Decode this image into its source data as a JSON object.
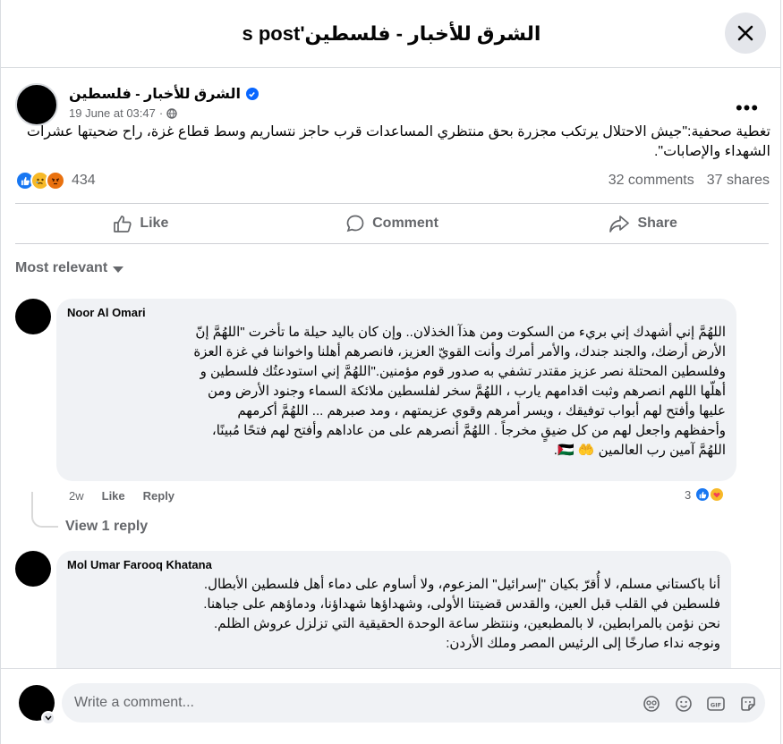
{
  "header": {
    "title": "الشرق للأخبار - فلسطين's post"
  },
  "post": {
    "author": "الشرق للأخبار - فلسطين",
    "time": "19 June at 03:47",
    "text": "تغطية صحفية:\"جيش الاحتلال يرتكب مجزرة بحق منتظري المساعدات قرب حاجز نتساريم وسط قطاع غزة، راح ضحيتها عشرات الشهداء والإصابات\".",
    "reaction_count": "434",
    "comments": "32 comments",
    "shares": "37 shares"
  },
  "actions": {
    "like": "Like",
    "comment": "Comment",
    "share": "Share"
  },
  "sort": {
    "label": "Most relevant"
  },
  "comments": [
    {
      "name": "Noor Al Omari",
      "lines": [
        "اللهُمَّ إني أشهدك إني بريء من السكوت ومن هذآ الخذلان.. وإن كان باليد حيلة ما تأخرت \"اللهُمَّ إنّ",
        "الأرض أرضك، والجند جندك، والأمر أمرك وأنت القويّ العزيز، فانصرهم أهلنا واخواننا في غزة العزة",
        "وفلسطين المحتلة نصر عزيز مقتدر تشفي به صدور قوم مؤمنين.\"اللهُمَّ إني استودعتُك فلسطين و",
        "أهلّها اللهم انصرهم وثبت اقدامهم يارب ، اللهُمَّ سخر لفلسطين ملائكة السماء وجنود الأرض ومن",
        "عليها وأفتح لهم أبواب توفيقك ، ويسر أمرهم وقوي عزيمتهم ، ومد صبرهم ... اللهُمَّ أكرمهم",
        "وأحفظهم واجعل لهم من كل ضيقٍ مخرجاً . اللهُمَّ أنصرهم على من عاداهم وأفتح لهم فتحًا مُبينًا،",
        "اللهُمَّ آمين رب العالمين 🤲 🇵🇸."
      ],
      "time": "2w",
      "like": "Like",
      "reply": "Reply",
      "reaction_count": "3",
      "view_replies": "View 1 reply"
    },
    {
      "name": "Mol Umar Farooq Khatana",
      "lines": [
        "أنا باكستاني مسلم، لا أُقرّ بكيان \"إسرائيل\" المزعوم، ولا أساوم على دماء أهل فلسطين الأبطال.",
        "فلسطين في القلب قبل العين، والقدس قضيتنا الأولى، وشهداؤها شهداؤنا، ودماؤهم على جباهنا.",
        "نحن نؤمن بالمرابطين، لا بالمطبعين، وننتظر ساعة الوحدة الحقيقية التي تزلزل عروش الظلم.",
        "ونوجه نداء صارخًا إلى الرئيس المصر وملك الأردن:"
      ]
    }
  ],
  "composer": {
    "placeholder": "Write a comment..."
  },
  "colors": {
    "accent": "#0866ff",
    "secondary_text": "#65676b",
    "bubble": "#f0f2f5"
  }
}
